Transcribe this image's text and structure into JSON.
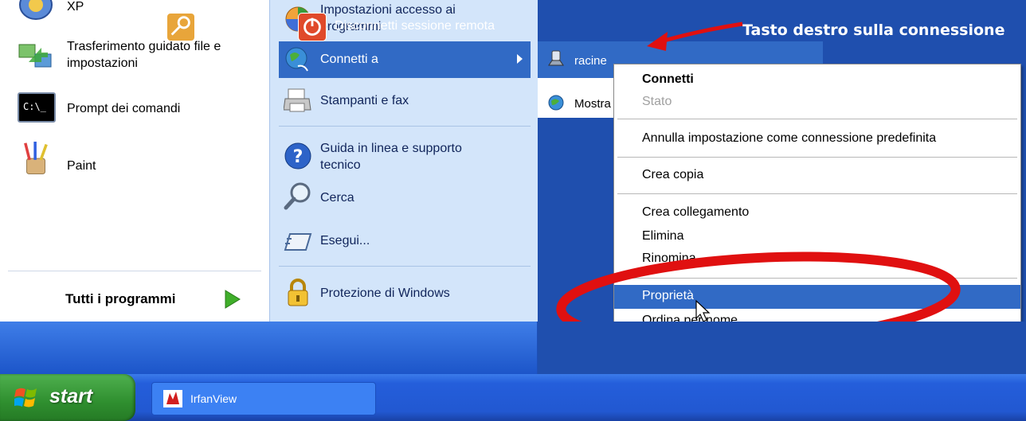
{
  "left_column": {
    "items": [
      {
        "label": "XP",
        "icon": "windows-xp-tour-icon"
      },
      {
        "label": "Trasferimento guidato file e\nimpostazioni",
        "icon": "transfer-wizard-icon"
      },
      {
        "label": "Prompt dei comandi",
        "icon": "command-prompt-icon",
        "icon_text": "C:\\_"
      },
      {
        "label": "Paint",
        "icon": "paint-icon"
      }
    ],
    "all_programs": "Tutti i programmi"
  },
  "middle_column": {
    "items": [
      {
        "label": "Impostazioni accesso ai\nprogrammi",
        "icon": "program-access-icon"
      },
      {
        "label": "Connetti a",
        "icon": "connect-to-icon"
      },
      {
        "label": "Stampanti e fax",
        "icon": "printer-icon"
      },
      {
        "label": "Guida in linea e supporto\ntecnico",
        "icon": "help-icon"
      },
      {
        "label": "Cerca",
        "icon": "search-icon"
      },
      {
        "label": "Esegui...",
        "icon": "run-icon"
      },
      {
        "label": "Protezione di Windows",
        "icon": "lock-icon"
      }
    ]
  },
  "submenu": {
    "items": [
      {
        "label": "racine",
        "icon": "dialup-connection-icon"
      },
      {
        "label": "Mostra",
        "icon": "network-icon"
      }
    ]
  },
  "annotation": {
    "text": "Tasto destro sulla connessione",
    "arrow_color": "#e01010",
    "circle_color": "#e01010"
  },
  "context_menu": {
    "items": [
      {
        "label": "Connetti",
        "bold": true
      },
      {
        "label": "Stato",
        "disabled": true
      },
      {
        "label": "Annulla impostazione come connessione predefinita"
      },
      {
        "label": "Crea copia"
      },
      {
        "label": "Crea collegamento"
      },
      {
        "label": "Elimina"
      },
      {
        "label": "Rinomina"
      },
      {
        "label": "Proprietà",
        "highlighted": true
      },
      {
        "label": "Ordina per nome"
      }
    ]
  },
  "bottom": {
    "logoff": "Disconnetti",
    "disconnect": "Disconnetti sessione remota"
  },
  "taskbar": {
    "start": "start",
    "apps": [
      {
        "label": "IrfanView",
        "icon": "irfanview-icon"
      }
    ]
  },
  "colors": {
    "highlight": "#316ac5",
    "start_green": "#3a9b3a",
    "taskbar_blue": "#245edb"
  }
}
